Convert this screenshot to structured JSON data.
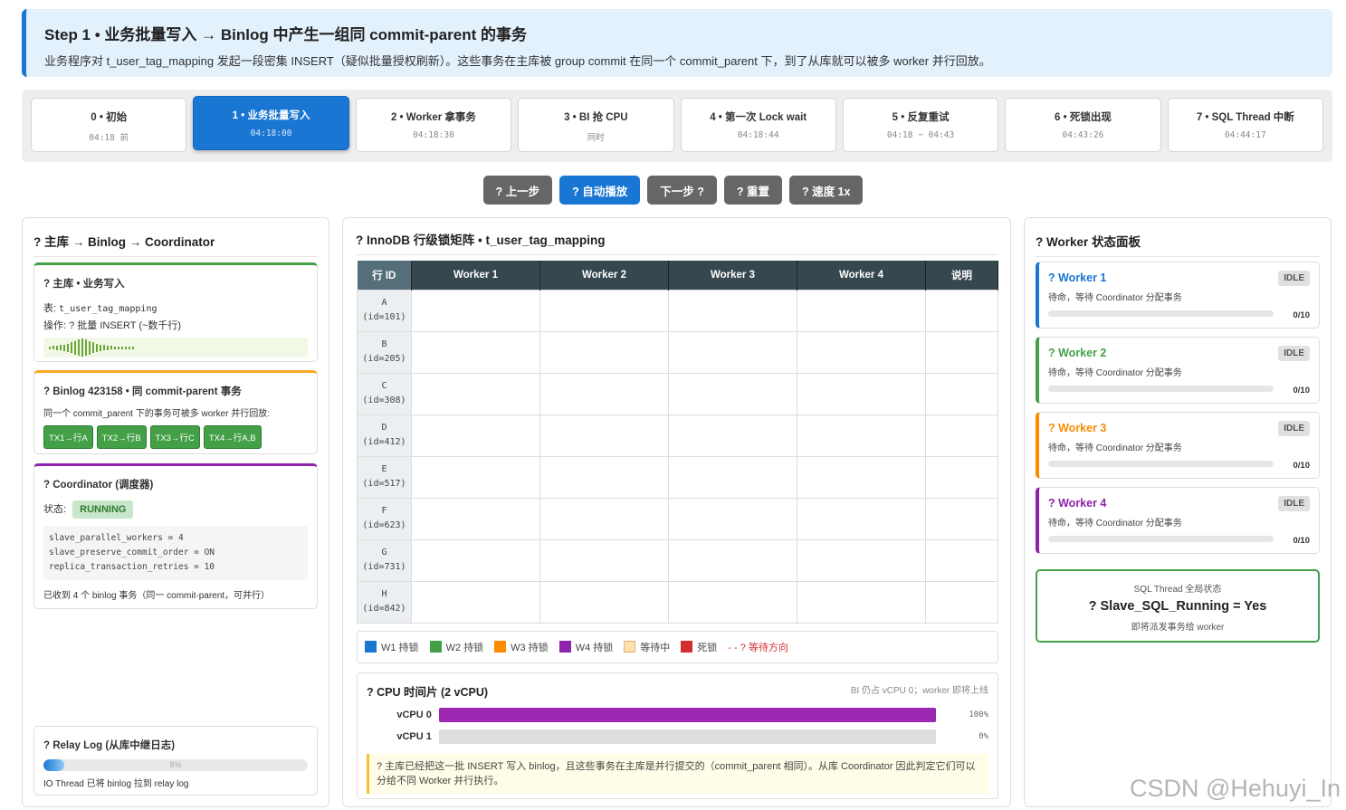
{
  "banner": {
    "title": "Step 1 • 业务批量写入 → Binlog 中产生一组同 commit-parent 的事务",
    "desc": "业务程序对 t_user_tag_mapping 发起一段密集 INSERT（疑似批量授权刷新）。这些事务在主库被 group commit 在同一个 commit_parent 下，到了从库就可以被多 worker 并行回放。"
  },
  "steps": [
    {
      "label": "0 • 初始",
      "time": "04:18 前"
    },
    {
      "label": "1 • 业务批量写入",
      "time": "04:18:00"
    },
    {
      "label": "2 • Worker 拿事务",
      "time": "04:18:30"
    },
    {
      "label": "3 • BI 抢 CPU",
      "time": "同时"
    },
    {
      "label": "4 • 第一次 Lock wait",
      "time": "04:18:44"
    },
    {
      "label": "5 • 反复重试",
      "time": "04:18 ~ 04:43"
    },
    {
      "label": "6 • 死锁出现",
      "time": "04:43:26"
    },
    {
      "label": "7 • SQL Thread 中断",
      "time": "04:44:17"
    }
  ],
  "controls": {
    "prev": "? 上一步",
    "auto": "? 自动播放",
    "next": "下一步 ?",
    "reset": "? 重置",
    "speed": "? 速度 1x"
  },
  "left": {
    "title": "? 主库 → Binlog → Coordinator",
    "master": {
      "title": "? 主库 • 业务写入",
      "table_prefix": "表: ",
      "table": "t_user_tag_mapping",
      "op": "操作: ? 批量 INSERT (~数千行)",
      "accent": "#43a047"
    },
    "binlog": {
      "title": "? Binlog 423158 • 同 commit-parent 事务",
      "desc": "同一个 commit_parent 下的事务可被多 worker 并行回放:",
      "txs": [
        "TX1→行A",
        "TX2→行B",
        "TX3→行C",
        "TX4→行A,B"
      ],
      "accent": "#f9a825"
    },
    "coordinator": {
      "title": "? Coordinator (调度器)",
      "status_label": "状态: ",
      "status": "RUNNING",
      "config": [
        "slave_parallel_workers = 4",
        "slave_preserve_commit_order = ON",
        "replica_transaction_retries = 10"
      ],
      "note": "已收到 4 个 binlog 事务（同一 commit-parent，可并行）",
      "accent": "#8e24aa"
    },
    "relay": {
      "title": "? Relay Log (从库中继日志)",
      "progress": 8,
      "progress_text": "8%",
      "note": "IO Thread 已将 binlog 拉到 relay log"
    }
  },
  "center": {
    "title": "? InnoDB 行级锁矩阵 • t_user_tag_mapping",
    "headers": [
      "行 ID",
      "Worker 1",
      "Worker 2",
      "Worker 3",
      "Worker 4",
      "说明"
    ],
    "rows": [
      {
        "letter": "A",
        "id": "(id=101)"
      },
      {
        "letter": "B",
        "id": "(id=205)"
      },
      {
        "letter": "C",
        "id": "(id=308)"
      },
      {
        "letter": "D",
        "id": "(id=412)"
      },
      {
        "letter": "E",
        "id": "(id=517)"
      },
      {
        "letter": "F",
        "id": "(id=623)"
      },
      {
        "letter": "G",
        "id": "(id=731)"
      },
      {
        "letter": "H",
        "id": "(id=842)"
      }
    ],
    "legend": [
      {
        "label": "W1 持锁",
        "color": "#1976d2"
      },
      {
        "label": "W2 持锁",
        "color": "#43a047"
      },
      {
        "label": "W3 持锁",
        "color": "#fb8c00"
      },
      {
        "label": "W4 持锁",
        "color": "#8e24aa"
      },
      {
        "label": "等待中",
        "color": "#ffe0b2"
      },
      {
        "label": "死锁",
        "color": "#d32f2f"
      }
    ],
    "legend_wait": "- - ? 等待方向",
    "cpu": {
      "title": "? CPU 时间片 (2 vCPU)",
      "note": "BI 仍占 vCPU 0；worker 即将上线",
      "rows": [
        {
          "label": "vCPU 0",
          "value": 100,
          "text": "100%"
        },
        {
          "label": "vCPU 1",
          "value": 0,
          "text": "0%"
        }
      ],
      "message": "? 主库已经把这一批 INSERT 写入 binlog，且这些事务在主库是并行提交的（commit_parent 相同）。从库 Coordinator 因此判定它们可以分给不同 Worker 并行执行。"
    }
  },
  "right": {
    "title": "? Worker 状态面板",
    "workers": [
      {
        "name": "? Worker 1",
        "status": "IDLE",
        "desc": "待命，等待 Coordinator 分配事务",
        "count": "0/10",
        "color": "#1976d2"
      },
      {
        "name": "? Worker 2",
        "status": "IDLE",
        "desc": "待命，等待 Coordinator 分配事务",
        "count": "0/10",
        "color": "#43a047"
      },
      {
        "name": "? Worker 3",
        "status": "IDLE",
        "desc": "待命，等待 Coordinator 分配事务",
        "count": "0/10",
        "color": "#fb8c00"
      },
      {
        "name": "? Worker 4",
        "status": "IDLE",
        "desc": "待命，等待 Coordinator 分配事务",
        "count": "0/10",
        "color": "#8e24aa"
      }
    ],
    "sql": {
      "label": "SQL Thread 全局状态",
      "value": "? Slave_SQL_Running = Yes",
      "note": "即将派发事务给 worker"
    }
  },
  "watermark": "CSDN @Hehuyi_In"
}
